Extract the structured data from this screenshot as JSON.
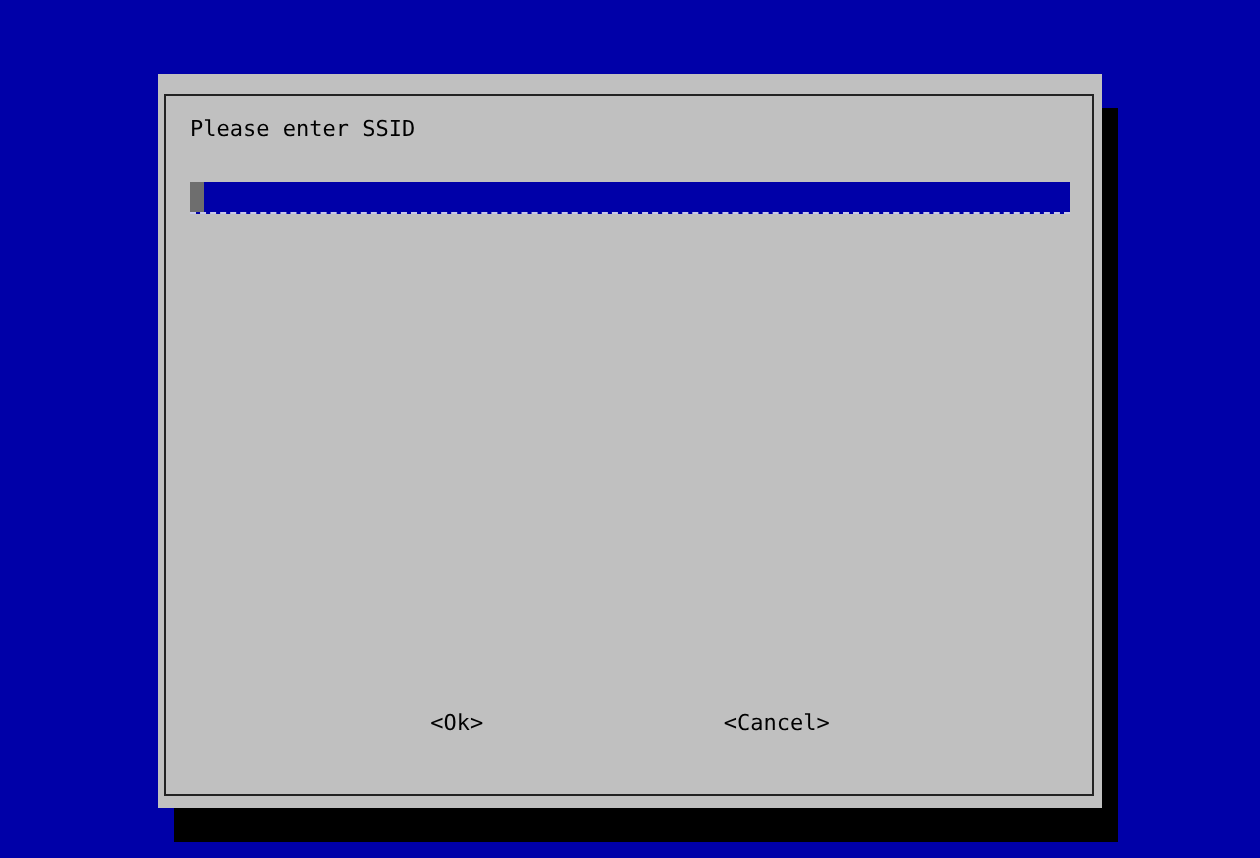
{
  "dialog": {
    "prompt": "Please enter SSID",
    "input": {
      "focused": true
    },
    "buttons": [
      {
        "label": "<Ok>",
        "selected": false
      },
      {
        "label": "<Cancel>",
        "selected": false
      }
    ]
  }
}
